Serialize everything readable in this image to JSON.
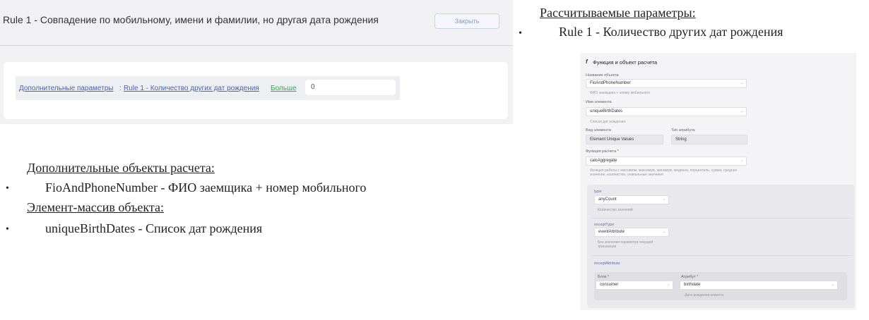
{
  "rule_panel": {
    "title": "Rule 1 - Совпадение по мобильному, имени и фамилии, но другая дата рождения",
    "close_label": "Закрыть",
    "param_link": "Дополнительные параметры",
    "param_separator": ":",
    "param_rule_link": "Rule 1 - Количество других дат рождения",
    "more_label": "Больше",
    "param_value": "0"
  },
  "left_text": {
    "additional_title": "Дополнительные объекты расчета:",
    "bullet": "•",
    "additional_item": "FioAndPhoneNumber - ФИО заемщика + номер мобильного",
    "array_title": "Элемент-массив объекта:",
    "array_item": "uniqueBirthDates - Список дат рождения"
  },
  "right_text": {
    "calc_title": "Рассчитываемые параметры:",
    "bullet": "•",
    "calc_item": "Rule 1 - Количество других дат рождения"
  },
  "form": {
    "fx_icon": "f",
    "header": "Функция и объект расчета",
    "object_label": "Название объекта",
    "object_value": "FioAndPhoneNumber",
    "object_hint": "ФИО заемщика + номер мобильного",
    "element_label": "Имя элемента",
    "element_value": "uniqueBirthDates",
    "element_hint": "Список дат рождения",
    "element_kind_label": "Вид элемента",
    "element_kind_value": "Element Unique Values",
    "attr_type_label": "Тип атрибута",
    "attr_type_value": "String",
    "calc_func_label": "Функция расчета *",
    "calc_func_value": "calcAggregate",
    "calc_func_hint": "Функция работы с массивом: максимум, минимум, медиана, перцентиль, сумма, среднее значение, количество, уникальные значения",
    "type_label": "type",
    "type_value": "anyCount",
    "type_hint": "Количество значений",
    "except_type_label": "exceptType",
    "except_type_value": "eventAttribute",
    "except_type_hint": "Без значения параметра текущей транзакции",
    "except_attribute_label": "exceptAttribute",
    "block_label": "Блок *",
    "block_value": "consumer",
    "attribute_label": "Атрибут *",
    "attribute_value": "birthdate",
    "attribute_hint": "Дата рождения клиента",
    "chevron": "⌄"
  }
}
